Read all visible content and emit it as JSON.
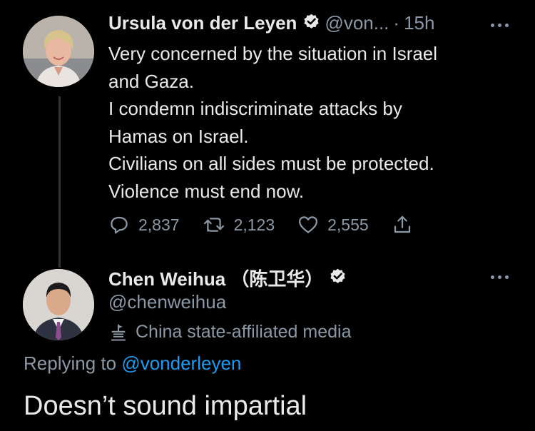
{
  "tweet1": {
    "author_name": "Ursula von der Leyen",
    "handle": "@von...",
    "separator": "·",
    "time": "15h",
    "text_lines": [
      "Very concerned by the situation in Israel",
      "and Gaza.",
      "I condemn indiscriminate attacks by",
      "Hamas on Israel.",
      "Civilians on all sides must be protected.",
      "Violence must end now."
    ],
    "replies": "2,837",
    "retweets": "2,123",
    "likes": "2,555"
  },
  "tweet2": {
    "author_name": "Chen Weihua （陈卫华）",
    "handle": "@chenweihua",
    "label": "China state-affiliated media",
    "replying_prefix": "Replying to",
    "replying_to": "@vonderleyen",
    "text": "Doesn’t sound impartial"
  },
  "colors": {
    "background": "#000000",
    "text": "#e7e9ea",
    "secondary": "#8b98a5",
    "link": "#1d9bf0"
  },
  "icons": [
    "verified-badge-icon",
    "more-icon",
    "reply-icon",
    "retweet-icon",
    "like-icon",
    "share-icon",
    "state-media-icon"
  ]
}
